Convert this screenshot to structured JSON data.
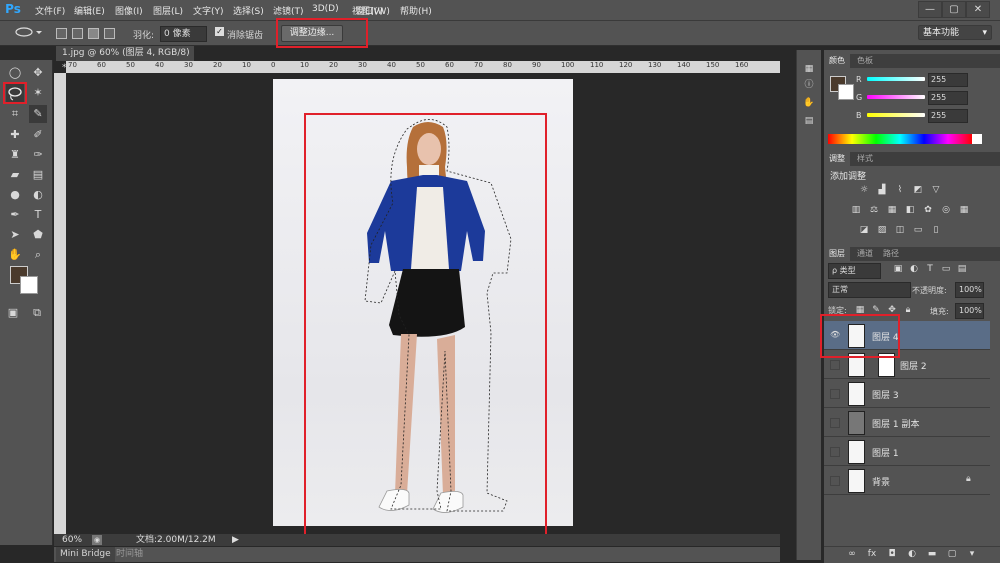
{
  "app": {
    "logo": "Ps"
  },
  "menu": [
    "文件(F)",
    "编辑(E)",
    "图像(I)",
    "图层(L)",
    "文字(Y)",
    "选择(S)",
    "滤镜(T)",
    "3D(D)",
    "视图(V)",
    "窗口(W)",
    "帮助(H)"
  ],
  "window_buttons": [
    "—",
    "▢",
    "✕"
  ],
  "options": {
    "feather_label": "羽化:",
    "feather_value": "0 像素",
    "antialias_label": "消除锯齿",
    "antialias_checked": true,
    "refine_edge_button": "调整边缘...",
    "workspace": "基本功能"
  },
  "document": {
    "tab_title": "1.jpg @ 60% (图层 4, RGB/8) *",
    "tab_close": "×",
    "zoom": "60%",
    "doc_size": "文档:2.00M/12.2M",
    "ruler_labels": [
      "70",
      "60",
      "50",
      "40",
      "30",
      "20",
      "10",
      "0",
      "10",
      "20",
      "30",
      "40",
      "50",
      "60",
      "70",
      "80",
      "90",
      "100",
      "110",
      "120",
      "130",
      "140",
      "150",
      "160"
    ]
  },
  "bottom_tabs": [
    "Mini Bridge",
    "时间轴"
  ],
  "color_panel": {
    "tabs": [
      "颜色",
      "色板"
    ],
    "channels": [
      {
        "label": "R",
        "value": "255",
        "gradient": "#00ffff"
      },
      {
        "label": "G",
        "value": "255",
        "gradient": "#ff00ff"
      },
      {
        "label": "B",
        "value": "255",
        "gradient": "#ffff00"
      }
    ],
    "foreground": "#4a3a2c",
    "background": "#ffffff"
  },
  "adjust_panel": {
    "tabs": [
      "调整",
      "样式"
    ],
    "title": "添加调整",
    "row1_icons": [
      "brightness-icon",
      "levels-icon",
      "curves-icon",
      "exposure-icon",
      "triangle-icon"
    ],
    "row2_icons": [
      "vibrance-icon",
      "balance-icon",
      "hue-icon",
      "bw-icon",
      "photo-filter-icon",
      "mixer-icon",
      "lookup-icon"
    ],
    "row3_icons": [
      "invert-icon",
      "posterize-icon",
      "threshold-icon",
      "map-icon",
      "selective-icon"
    ]
  },
  "layers_panel": {
    "tabs": [
      "图层",
      "通道",
      "路径"
    ],
    "filter_label": "ρ 类型",
    "blend_mode": "正常",
    "opacity_label": "不透明度:",
    "opacity_value": "100%",
    "lock_label": "锁定:",
    "fill_label": "填充:",
    "fill_value": "100%",
    "layers": [
      {
        "name": "图层 4",
        "visible": true,
        "selected": true,
        "mask": false
      },
      {
        "name": "图层 2",
        "visible": false,
        "selected": false,
        "mask": true
      },
      {
        "name": "图层 3",
        "visible": false,
        "selected": false,
        "mask": false
      },
      {
        "name": "图层 1 副本",
        "visible": false,
        "selected": false,
        "mask": false
      },
      {
        "name": "图层 1",
        "visible": false,
        "selected": false,
        "mask": false
      },
      {
        "name": "背景",
        "visible": false,
        "selected": false,
        "mask": false
      }
    ],
    "footer_icons": [
      "link-icon",
      "fx-icon",
      "mask-icon",
      "adjustment-icon",
      "group-icon",
      "new-layer-icon",
      "trash-icon"
    ]
  },
  "highlight_color": "#e0202a"
}
